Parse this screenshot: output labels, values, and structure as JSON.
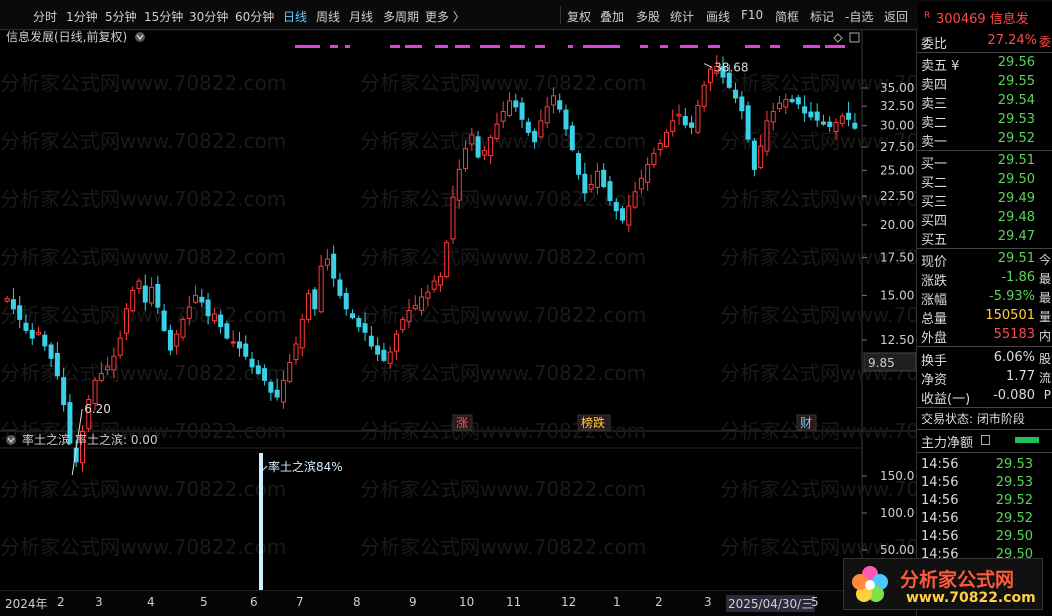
{
  "toolbar": {
    "periods": [
      "分时",
      "1分钟",
      "5分钟",
      "15分钟",
      "30分钟",
      "60分钟",
      "日线",
      "周线",
      "月线",
      "多周期",
      "更多 〉"
    ],
    "active_period": "日线",
    "buttons": [
      "复权",
      "叠加",
      "多股",
      "统计",
      "画线",
      "F10",
      "简框",
      "标记",
      "-自选",
      "返回"
    ]
  },
  "quote_header": {
    "badge": "R",
    "code": "300469",
    "name": "信息发"
  },
  "chart": {
    "title": "信息发展(日线,前复权)",
    "high_label": "38.68",
    "low_label": "6.20",
    "price_axis": [
      "35.00",
      "32.50",
      "30.00",
      "27.50",
      "25.00",
      "22.50",
      "20.00",
      "17.50",
      "15.00",
      "12.50"
    ],
    "axis_readout": "9.85",
    "markers": [
      {
        "text": "涨",
        "color": "#ff5050"
      },
      {
        "text": "榜跌",
        "color": "#ffd040"
      },
      {
        "text": "财",
        "color": "#6cc6ff"
      }
    ],
    "watermark": "分析家公式网www.70822.com",
    "sub_title": "率土之滨",
    "sub_value": "率土之滨: 0.00",
    "sub_annotation": "率土之滨84%",
    "sub_axis": [
      "150.0",
      "100.0",
      "50.00"
    ]
  },
  "chart_data": {
    "type": "candlestick",
    "title": "信息发展(日线,前复权)",
    "high": 38.68,
    "low": 6.2,
    "ylim": [
      9.85,
      38.68
    ],
    "y_ticks": [
      35.0,
      32.5,
      30.0,
      27.5,
      25.0,
      22.5,
      20.0,
      17.5,
      15.0,
      12.5
    ],
    "x_ticks": [
      "2024年",
      "2",
      "3",
      "4",
      "5",
      "6",
      "7",
      "8",
      "9",
      "10",
      "11",
      "12",
      "1",
      "2",
      "3",
      "2025/04/30/三",
      "5"
    ],
    "sub_series": {
      "name": "率土之滨",
      "value": 0.0,
      "spike_label": "率土之滨84%",
      "y_ticks": [
        150.0,
        100.0,
        50.0
      ]
    },
    "close_series": [
      14.8,
      14.2,
      13.6,
      13.0,
      12.6,
      12.9,
      12.2,
      11.6,
      10.8,
      9.6,
      8.2,
      7.6,
      8.6,
      9.8,
      10.6,
      10.9,
      11.2,
      11.7,
      12.6,
      14.2,
      15.3,
      15.9,
      14.6,
      15.5,
      14.3,
      13.0,
      12.0,
      12.8,
      13.6,
      14.3,
      15.0,
      14.6,
      13.8,
      13.9,
      13.2,
      12.6,
      12.4,
      12.1,
      11.7,
      11.2,
      10.9,
      10.6,
      10.1,
      9.9,
      10.6,
      11.4,
      12.3,
      13.6,
      15.1,
      14.2,
      16.9,
      17.4,
      16.1,
      15.0,
      14.2,
      13.7,
      13.2,
      12.9,
      12.2,
      11.8,
      11.5,
      11.9,
      12.8,
      13.6,
      14.1,
      14.4,
      14.9,
      15.2,
      15.9,
      16.2,
      18.6,
      22.4,
      25.1,
      27.3,
      28.9,
      26.4,
      27.1,
      28.6,
      30.2,
      31.8,
      33.2,
      32.4,
      30.8,
      29.2,
      28.1,
      30.6,
      32.4,
      33.9,
      32.1,
      29.6,
      27.2,
      24.6,
      22.8,
      23.6,
      24.9,
      23.4,
      22.1,
      21.2,
      20.4,
      21.6,
      22.9,
      24.2,
      25.6,
      26.8,
      27.9,
      29.2,
      30.6,
      31.4,
      30.1,
      29.8,
      32.6,
      35.4,
      37.8,
      38.2,
      36.6,
      35.1,
      33.6,
      31.9,
      28.4,
      25.1,
      27.6,
      30.6,
      31.8,
      32.9,
      33.4,
      33.1,
      32.8,
      31.6,
      31.1,
      30.7,
      30.2,
      29.9,
      30.4,
      31.2,
      30.8,
      29.7
    ]
  },
  "sidebar": {
    "ratio": {
      "label": "委比",
      "value": "27.24%",
      "extra": "委"
    },
    "asks": [
      {
        "label": "卖五 ¥",
        "price": "29.56"
      },
      {
        "label": "卖四",
        "price": "29.55"
      },
      {
        "label": "卖三",
        "price": "29.54"
      },
      {
        "label": "卖二",
        "price": "29.53"
      },
      {
        "label": "卖一",
        "price": "29.52"
      }
    ],
    "bids": [
      {
        "label": "买一",
        "price": "29.51"
      },
      {
        "label": "买二",
        "price": "29.50"
      },
      {
        "label": "买三",
        "price": "29.49"
      },
      {
        "label": "买四",
        "price": "29.48"
      },
      {
        "label": "买五",
        "price": "29.47"
      }
    ],
    "stats": [
      {
        "label": "现价",
        "value": "29.51",
        "color": "#5bd45b",
        "tail": "今"
      },
      {
        "label": "涨跌",
        "value": "-1.86",
        "color": "#5bd45b",
        "tail": "最"
      },
      {
        "label": "涨幅",
        "value": "-5.93%",
        "color": "#5bd45b",
        "tail": "最"
      },
      {
        "label": "总量",
        "value": "150501",
        "color": "#ffd040",
        "tail": "量"
      },
      {
        "label": "外盘",
        "value": "55183",
        "color": "#ff4a4a",
        "tail": "内"
      }
    ],
    "stats2": [
      {
        "label": "换手",
        "value": "6.06%",
        "color": "#dcdcdc",
        "tail": "股"
      },
      {
        "label": "净资",
        "value": "1.77",
        "color": "#dcdcdc",
        "tail": "流"
      },
      {
        "label": "收益(一)",
        "value": "-0.080",
        "color": "#dcdcdc",
        "tail": "P"
      }
    ],
    "trade_status": "交易状态: 闭市阶段",
    "flow_label": "主力净额",
    "ticks": [
      {
        "time": "14:56",
        "price": "29.53"
      },
      {
        "time": "14:56",
        "price": "29.53"
      },
      {
        "time": "14:56",
        "price": "29.52"
      },
      {
        "time": "14:56",
        "price": "29.52"
      },
      {
        "time": "14:56",
        "price": "29.50"
      },
      {
        "time": "14:56",
        "price": "29.50"
      }
    ]
  },
  "logo": {
    "text": "分析家公式网",
    "url": "www.70822.com"
  }
}
